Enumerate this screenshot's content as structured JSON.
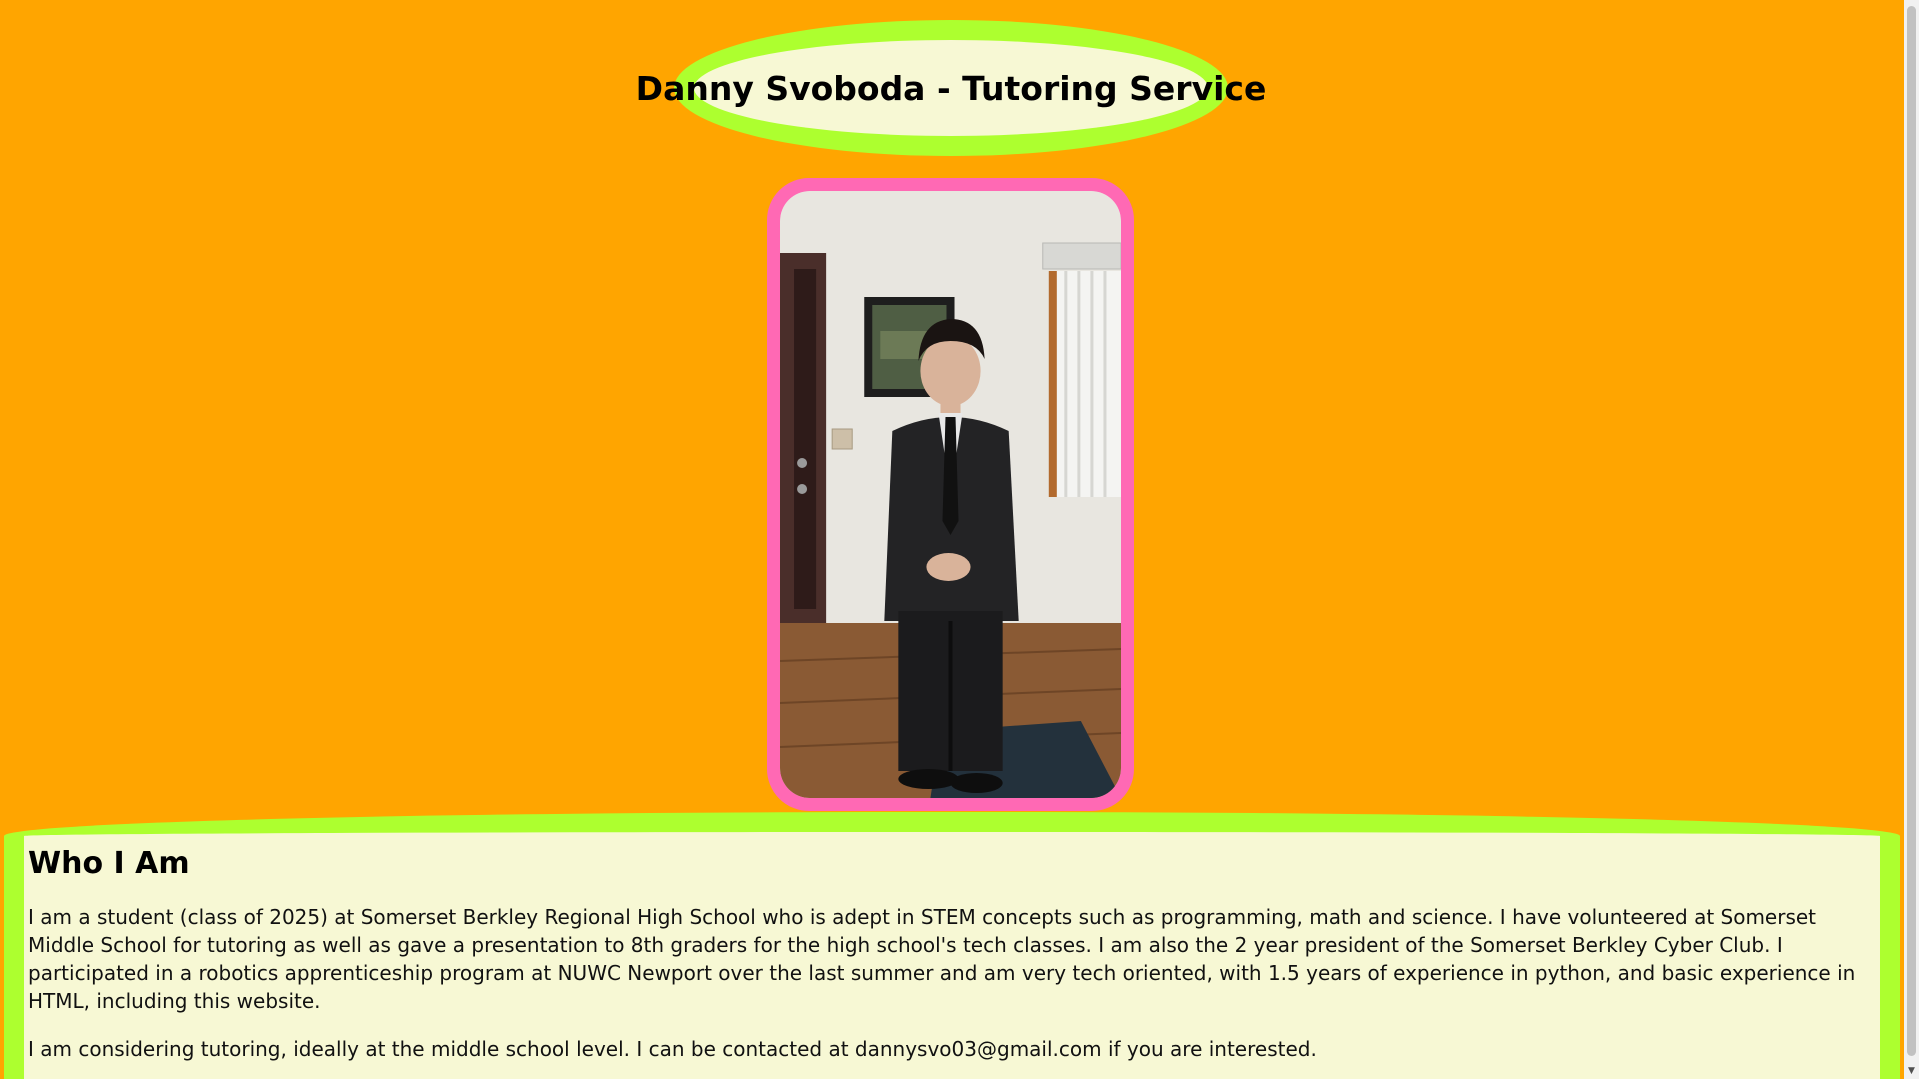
{
  "header": {
    "title": "Danny Svoboda - Tutoring Service"
  },
  "photo": {
    "alt": "Danny Svoboda photo"
  },
  "about": {
    "heading": "Who I Am",
    "paragraphs": [
      "I am a student (class of 2025) at Somerset Berkley Regional High School who is adept in STEM concepts such as programming, math and science. I have volunteered at Somerset Middle School for tutoring as well as gave a presentation to 8th graders for the high school's tech classes. I am also the 2 year president of the Somerset Berkley Cyber Club. I participated in a robotics apprenticeship program at NUWC Newport over the last summer and am very tech oriented, with 1.5 years of experience in python, and basic experience in HTML, including this website.",
      "I am considering tutoring, ideally at the middle school level. I can be contacted at dannysvo03@gmail.com if you are interested."
    ]
  },
  "colors": {
    "background": "#ffa500",
    "card_border": "#adff2f",
    "card_fill": "#f7f8d4",
    "photo_border": "#ff69b4"
  },
  "scrollbar": {
    "down_arrow_icon": "chevron-down-icon"
  }
}
